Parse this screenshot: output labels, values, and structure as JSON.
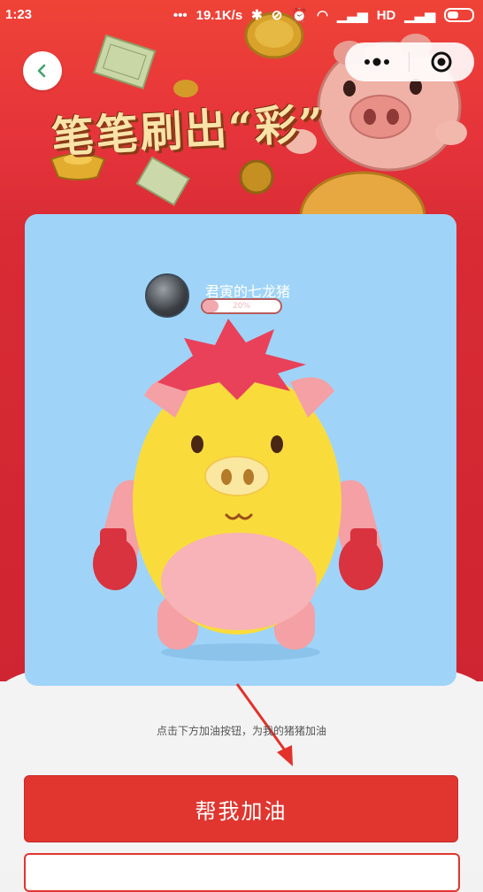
{
  "status_bar": {
    "time": "1:23",
    "network_speed": "19.1K/s",
    "hd_label": "HD"
  },
  "banner": {
    "slogan": "笔笔刷出“彩”"
  },
  "pig_card": {
    "name": "君寅的七龙猪",
    "progress_text": "20%",
    "progress_fraction": 0.2
  },
  "hint_text": "点击下方加油按钮，为我的猪猪加油",
  "cheer_button_label": "帮我加油",
  "colors": {
    "primary_red": "#e0362f",
    "card_blue": "#9fd4f8",
    "pig_yellow": "#f9dc3c",
    "pig_pink": "#f4a0a5"
  },
  "icons": [
    "back-chevron-icon",
    "more-dots-icon",
    "close-target-icon"
  ]
}
